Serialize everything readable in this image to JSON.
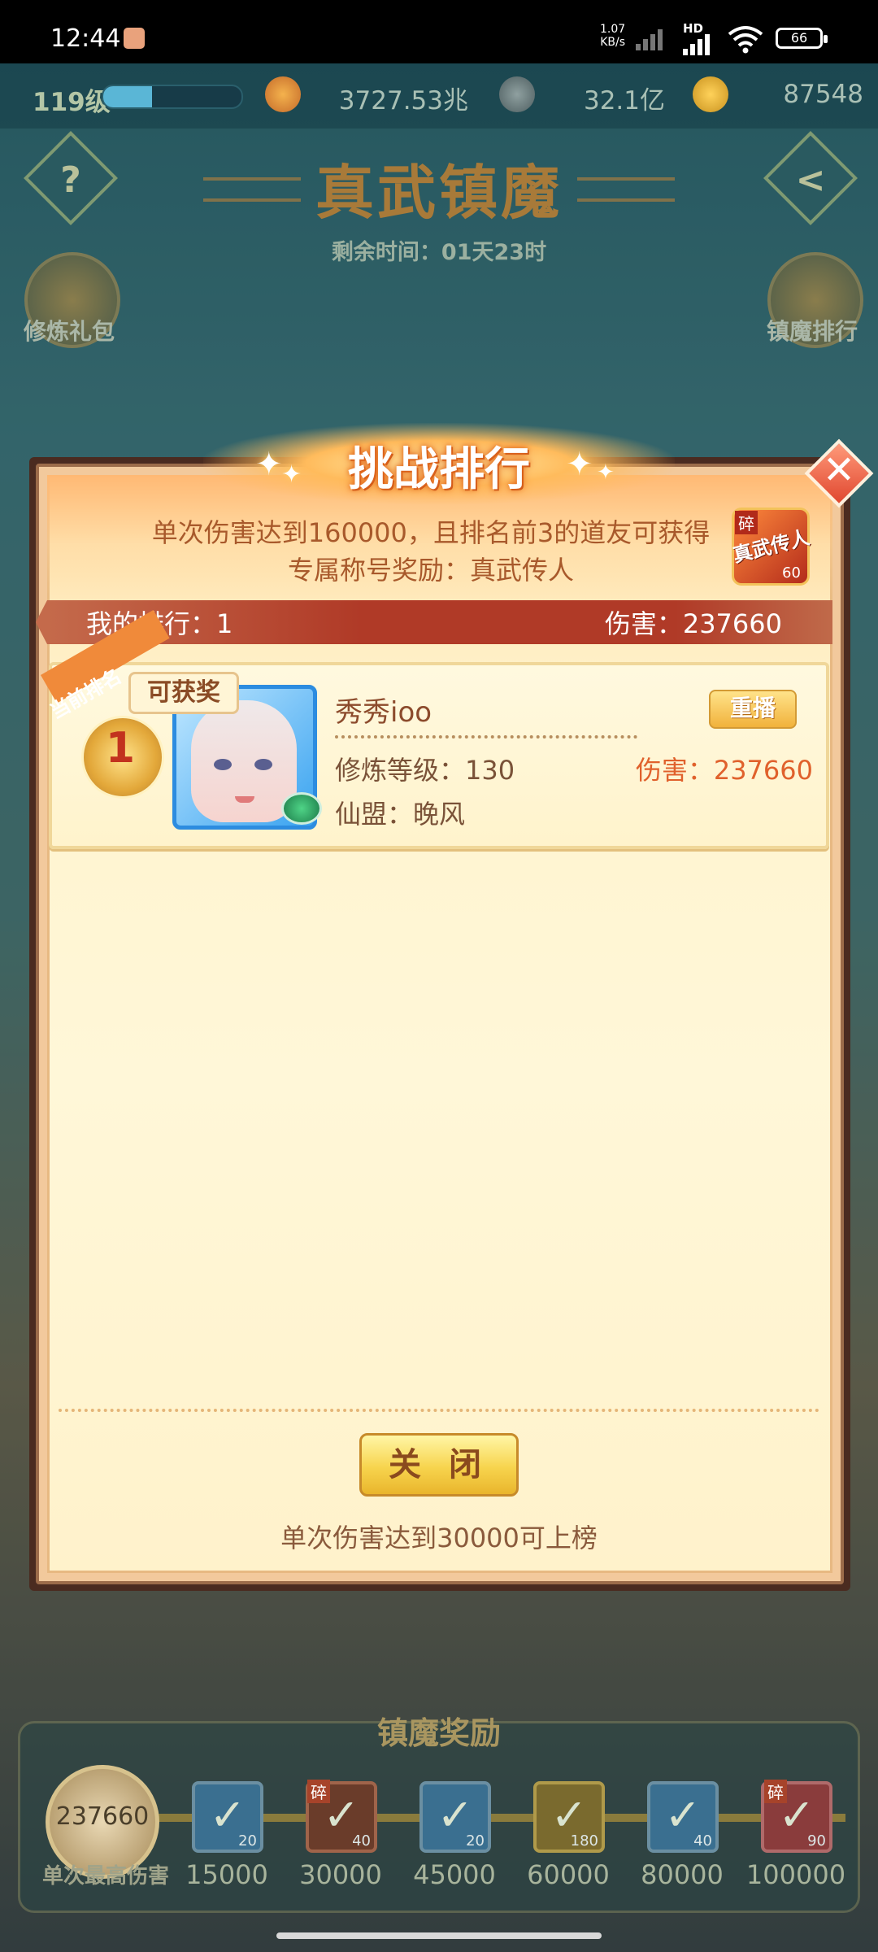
{
  "status_bar": {
    "time": "12:44",
    "speed_value": "1.07",
    "speed_unit": "KB/s",
    "hd": "HD",
    "battery": "66"
  },
  "resources": {
    "level": "119级",
    "level_progress": 0.35,
    "combat_power": "3727.53兆",
    "coins": "32.1亿",
    "gold": "87548"
  },
  "event": {
    "title": "真武镇魔",
    "remaining_time": "剩余时间：01天23时",
    "help_glyph": "?",
    "back_glyph": "<"
  },
  "side_buttons": {
    "left": "修炼礼包",
    "right": "镇魔排行"
  },
  "modal": {
    "title": "挑战排行",
    "reward_line1": "单次伤害达到160000，且排名前3的道友可获得",
    "reward_line2": "专属称号奖励：真武传人",
    "badge": {
      "fragment": "碎",
      "name": "真武传人",
      "count": "60"
    },
    "my_rank": "我的排行：1",
    "my_damage": "伤害：237660",
    "entry": {
      "ribbon": "当前排名",
      "rank": "1",
      "award_tag": "可获奖",
      "name": "秀秀ioo",
      "replay": "重播",
      "cultivation": "修炼等级：130",
      "damage": "伤害：237660",
      "guild": "仙盟：晚风"
    },
    "close": "关 闭",
    "footer": "单次伤害达到30000可上榜",
    "close_glyph": "✕"
  },
  "rewards": {
    "title": "镇魔奖励",
    "best_damage": "237660",
    "best_label": "单次最高伤害",
    "milestones": [
      {
        "value": "15000",
        "count": "20",
        "fragment": ""
      },
      {
        "value": "30000",
        "count": "40",
        "fragment": "碎"
      },
      {
        "value": "45000",
        "count": "20",
        "fragment": ""
      },
      {
        "value": "60000",
        "count": "180",
        "fragment": ""
      },
      {
        "value": "80000",
        "count": "40",
        "fragment": ""
      },
      {
        "value": "100000",
        "count": "90",
        "fragment": "碎"
      }
    ]
  },
  "colors": {
    "accent_orange": "#e0612c",
    "rank_bar": "#b03a27",
    "title_gold": "#a87a39"
  }
}
